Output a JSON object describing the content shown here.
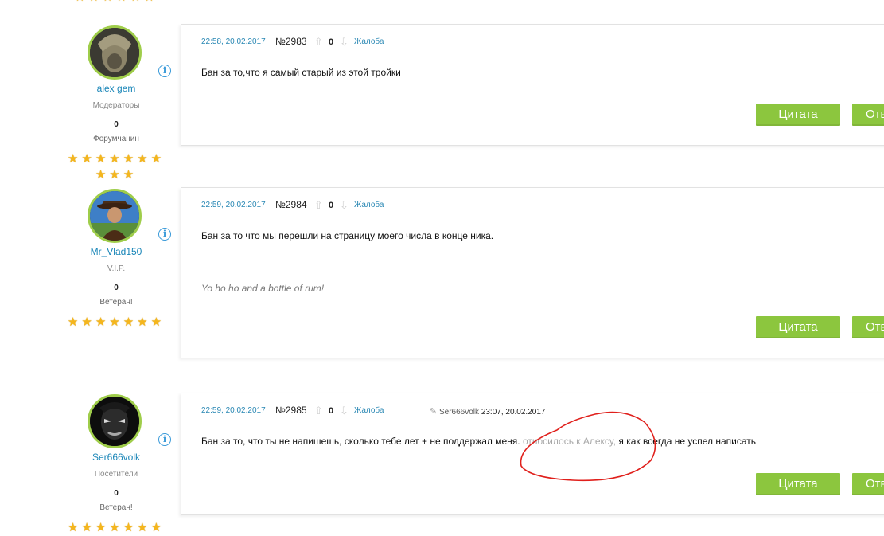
{
  "stars_top_partial": "★★★★★★",
  "posts": [
    {
      "username": "alex gem",
      "group": "Модераторы",
      "count": "0",
      "rank": "Форумчанин",
      "stars_row1": "★★★★★★★",
      "stars_row2": "★★★",
      "date": "22:58, 20.02.2017",
      "number": "№2983",
      "score": "0",
      "report": "Жалоба",
      "text": "Бан за то,что я самый старый из этой тройки",
      "quote_label": "Цитата",
      "reply_label": "Отв"
    },
    {
      "username": "Mr_Vlad150",
      "group": "V.I.P.",
      "count": "0",
      "rank": "Ветеран!",
      "stars_row1": "★★★★★★★",
      "date": "22:59, 20.02.2017",
      "number": "№2984",
      "score": "0",
      "report": "Жалоба",
      "text": "Бан за то что мы перешли на страницу моего числа в конце ника.",
      "signature": "Yo ho ho and a bottle of rum!",
      "quote_label": "Цитата",
      "reply_label": "Отв"
    },
    {
      "username": "Ser666volk",
      "group": "Посетители",
      "count": "0",
      "rank": "Ветеран!",
      "stars_row1": "★★★★★★★",
      "date": "22:59, 20.02.2017",
      "number": "№2985",
      "score": "0",
      "report": "Жалоба",
      "edited_by": "Ser666volk",
      "edited_at": "23:07, 20.02.2017",
      "text_part1": "Бан за то, что ты не напишешь, сколько тебе лет + не поддержал меня.",
      "text_part2": " относилось к Алексу,",
      "text_part3": " я как всегда не успел написать",
      "quote_label": "Цитата",
      "reply_label": "Отв"
    }
  ],
  "colors": {
    "accent_green": "#8cc63e",
    "link_blue": "#2a88b4",
    "star_gold": "#f5b61c",
    "scribble_red": "#e0201c"
  },
  "icons": [
    "info-icon",
    "arrow-up-icon",
    "arrow-down-icon",
    "pencil-icon",
    "star-icon"
  ]
}
